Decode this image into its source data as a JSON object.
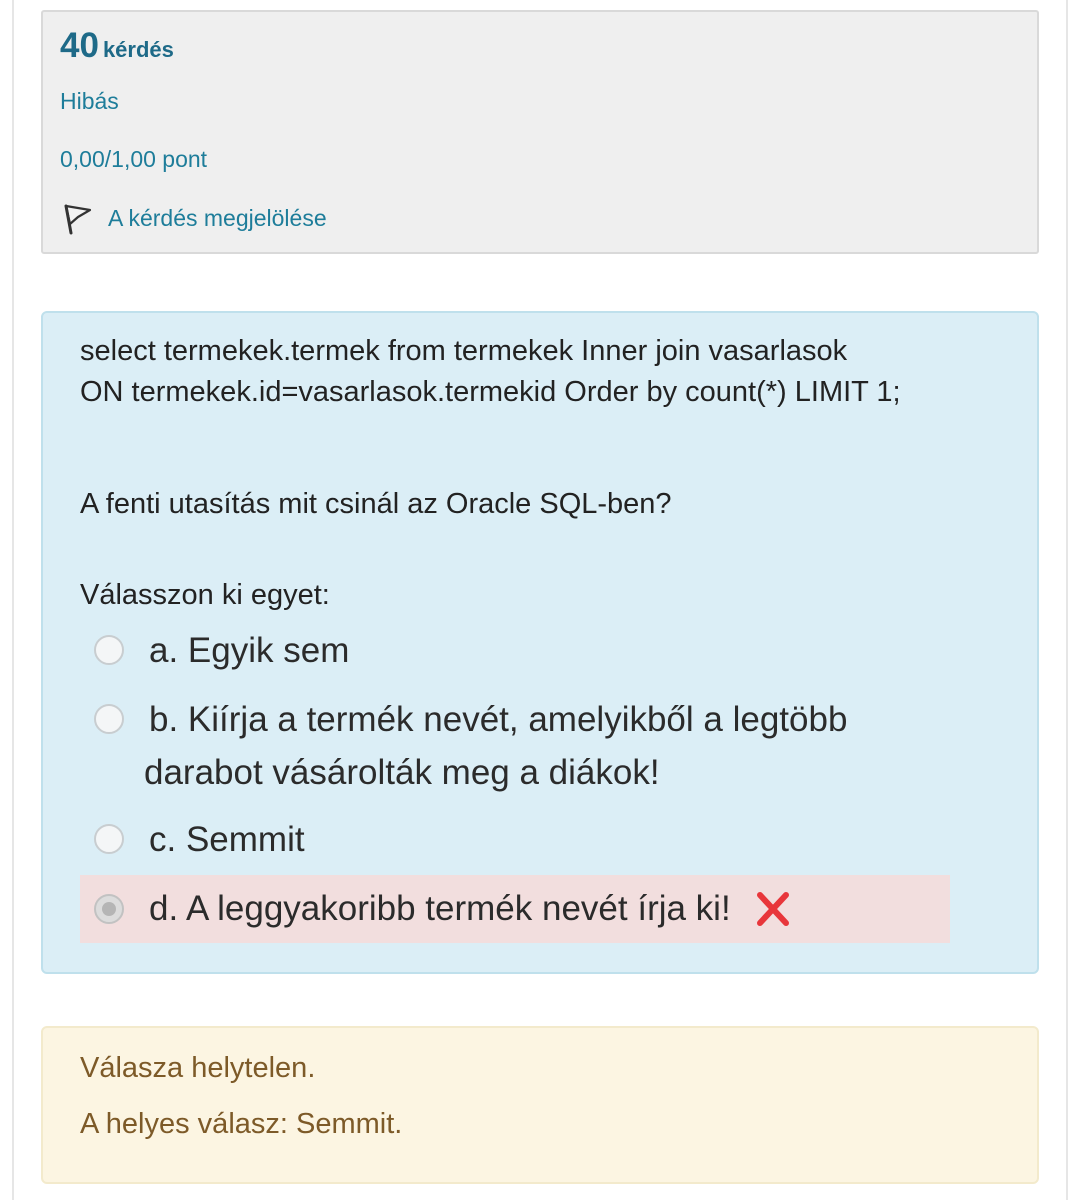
{
  "question_info": {
    "number": "40",
    "number_label": "kérdés",
    "state": "Hibás",
    "grade": "0,00/1,00 pont",
    "flag_label": "A kérdés megjelölése"
  },
  "question": {
    "text_lines": [
      "select termekek.termek from termekek Inner join vasarlasok",
      "ON termekek.id=vasarlasok.termekid Order by count(*) LIMIT 1;",
      "A fenti utasítás mit csinál az Oracle SQL-ben?"
    ],
    "prompt": "Válasszon ki egyet:",
    "options": [
      {
        "label": "a. Egyik sem",
        "selected": false
      },
      {
        "label_line1": "b. Kiírja a termék nevét, amelyikből a legtöbb",
        "label_line2": "darabot vásárolták meg a diákok!",
        "selected": false
      },
      {
        "label": "c. Semmit",
        "selected": false
      },
      {
        "label": "d. A leggyakoribb termék nevét írja ki!",
        "selected": true,
        "status_icon": "red-x-icon"
      }
    ]
  },
  "feedback": {
    "result": "Válasza helytelen.",
    "correct_answer": "A helyes válasz: Semmit."
  },
  "colors": {
    "info_bg": "#efefef",
    "question_bg": "#dbeef6",
    "incorrect_highlight": "#f2dede",
    "feedback_bg": "#fcf5e2",
    "link_blue": "#1e7d9a",
    "feedback_text": "#7d5a28",
    "wrong_mark": "#e8363b"
  }
}
